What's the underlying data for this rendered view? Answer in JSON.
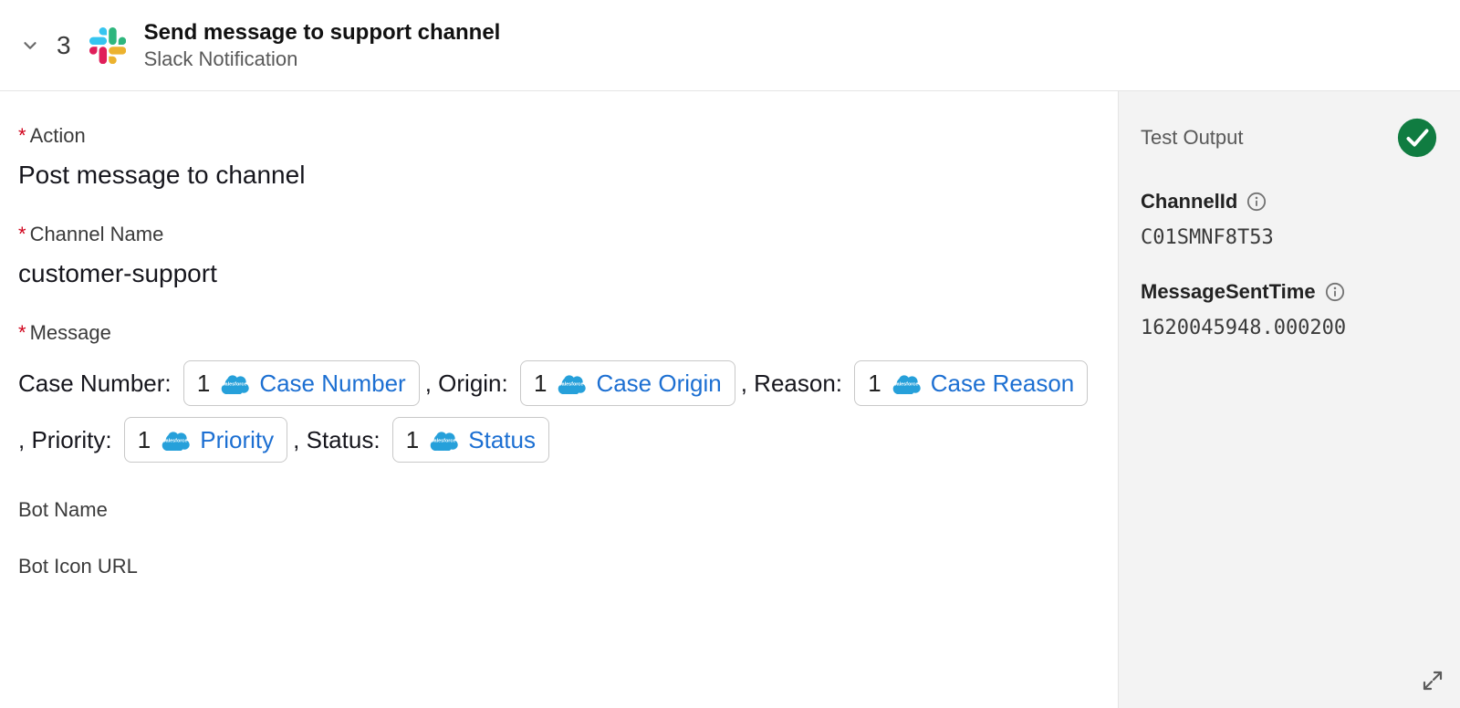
{
  "header": {
    "step_number": "3",
    "title": "Send message to support channel",
    "subtitle": "Slack Notification"
  },
  "fields": {
    "action": {
      "label": "Action",
      "required": true,
      "value": "Post message to channel"
    },
    "channel_name": {
      "label": "Channel Name",
      "required": true,
      "value": "customer-support"
    },
    "message": {
      "label": "Message",
      "required": true,
      "segments": [
        {
          "type": "text",
          "text": "Case Number: "
        },
        {
          "type": "pill",
          "num": "1",
          "label": "Case Number"
        },
        {
          "type": "text",
          "text": ", Origin: "
        },
        {
          "type": "pill",
          "num": "1",
          "label": "Case Origin"
        },
        {
          "type": "text",
          "text": ", Reason: "
        },
        {
          "type": "pill",
          "num": "1",
          "label": "Case Reason"
        },
        {
          "type": "text",
          "text": ", Priority: "
        },
        {
          "type": "pill",
          "num": "1",
          "label": "Priority"
        },
        {
          "type": "text",
          "text": ", Status: "
        },
        {
          "type": "pill",
          "num": "1",
          "label": "Status"
        }
      ]
    },
    "bot_name": {
      "label": "Bot Name",
      "required": false,
      "value": ""
    },
    "bot_icon_url": {
      "label": "Bot Icon URL",
      "required": false,
      "value": ""
    }
  },
  "output": {
    "title": "Test Output",
    "success": true,
    "items": [
      {
        "label": "ChannelId",
        "value": "C01SMNF8T53"
      },
      {
        "label": "MessageSentTime",
        "value": "1620045948.000200"
      }
    ]
  }
}
